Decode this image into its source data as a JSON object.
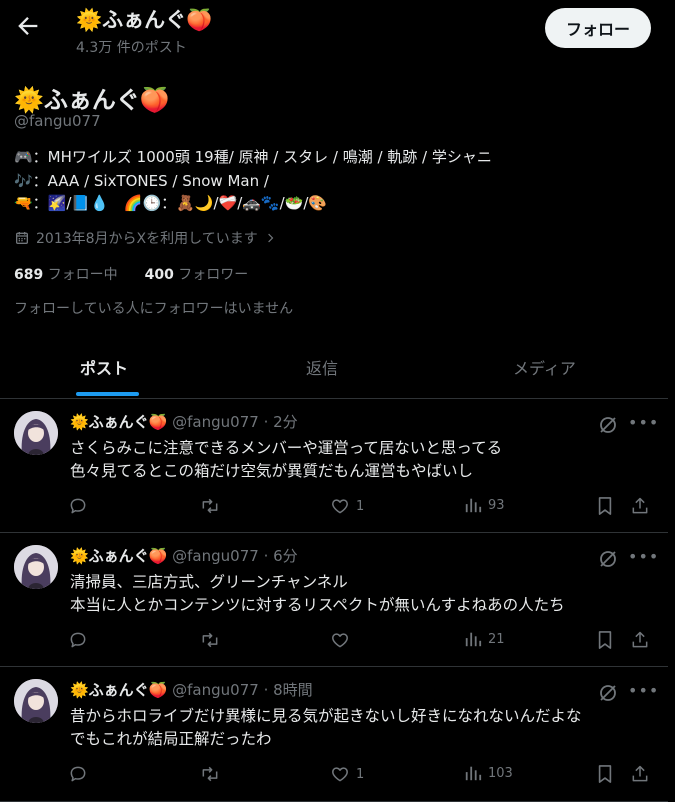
{
  "header": {
    "name": "🌞ふぁんぐ🍑",
    "post_count": "4.3万 件のポスト",
    "follow_label": "フォロー"
  },
  "profile": {
    "name": "🌞ふぁんぐ🍑",
    "handle": "@fangu077",
    "bio": [
      "🎮：MHワイルズ 1000頭 19種/ 原神 / スタレ / 鳴潮 / 軌跡 / 学シャニ",
      "🎶：AAA / SixTONES / Snow Man /",
      "🔫：🌠/📘💧　🌈🕒：🧸🌙/❤️‍🩹/🚓🐾/🥗/🎨"
    ],
    "joined": "2013年8月からXを利用しています",
    "following_count": "689",
    "following_label": "フォロー中",
    "followers_count": "400",
    "followers_label": "フォロワー",
    "no_followers_note": "フォローしている人にフォロワーはいません"
  },
  "tabs": [
    "ポスト",
    "返信",
    "メディア"
  ],
  "tweets": [
    {
      "name": "🌞ふぁんぐ🍑",
      "handle": "@fangu077",
      "time": "· 2分",
      "lines": [
        "さくらみこに注意できるメンバーや運営って居ないと思ってる",
        "色々見てるとこの箱だけ空気が異質だもん運営もやばいし"
      ],
      "likes": "1",
      "views": "93"
    },
    {
      "name": "🌞ふぁんぐ🍑",
      "handle": "@fangu077",
      "time": "· 6分",
      "lines": [
        "清掃員、三店方式、グリーンチャンネル",
        "本当に人とかコンテンツに対するリスペクトが無いんすよねあの人たち"
      ],
      "likes": "",
      "views": "21"
    },
    {
      "name": "🌞ふぁんぐ🍑",
      "handle": "@fangu077",
      "time": "· 8時間",
      "lines": [
        "昔からホロライブだけ異様に見る気が起きないし好きになれないんだよな",
        "でもこれが結局正解だったわ"
      ],
      "likes": "1",
      "views": "103"
    }
  ],
  "colors": {
    "accent": "#1d9bf0",
    "muted": "#71767b",
    "text": "#e7e9ea",
    "divider": "#2f3336"
  },
  "icons": [
    "back-arrow-icon",
    "calendar-icon",
    "chevron-right-icon",
    "grok-icon",
    "more-icon",
    "reply-icon",
    "retweet-icon",
    "like-icon",
    "views-icon",
    "bookmark-icon",
    "share-icon"
  ]
}
